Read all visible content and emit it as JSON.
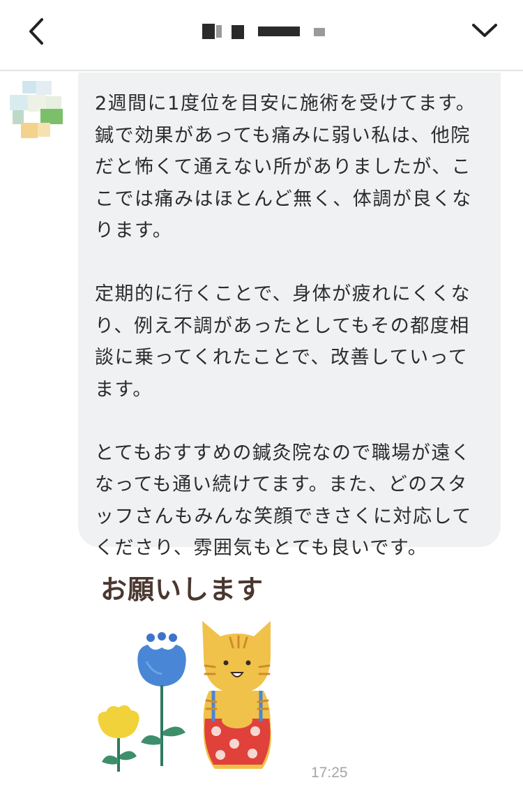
{
  "header": {
    "title": "",
    "back_icon": "chevron-left-icon",
    "menu_icon": "chevron-down-icon"
  },
  "message": {
    "text": "2週間に1度位を目安に施術を受けてます。鍼で効果があっても痛みに弱い私は、他院だと怖くて通えない所がありましたが、ここでは痛みはほとんど無く、体調が良くなります。\n\n定期的に行くことで、身体が疲れにくくなり、例え不調があったとしてもその都度相談に乗ってくれたことで、改善していってます。\n\nとてもおすすめの鍼灸院なので職場が遠くなっても通い続けてます。また、どのスタッフさんもみんな笑顔できさくに対応してくださり、雰囲気もとても良いです。"
  },
  "sticker": {
    "caption": "お願いします",
    "art": "cat-with-flowers-sticker"
  },
  "time": "17:25",
  "colors": {
    "bubble": "#f0f1f3",
    "text": "#2b2b2b",
    "time": "#a4a4a4",
    "divider": "#e3e3e3"
  }
}
